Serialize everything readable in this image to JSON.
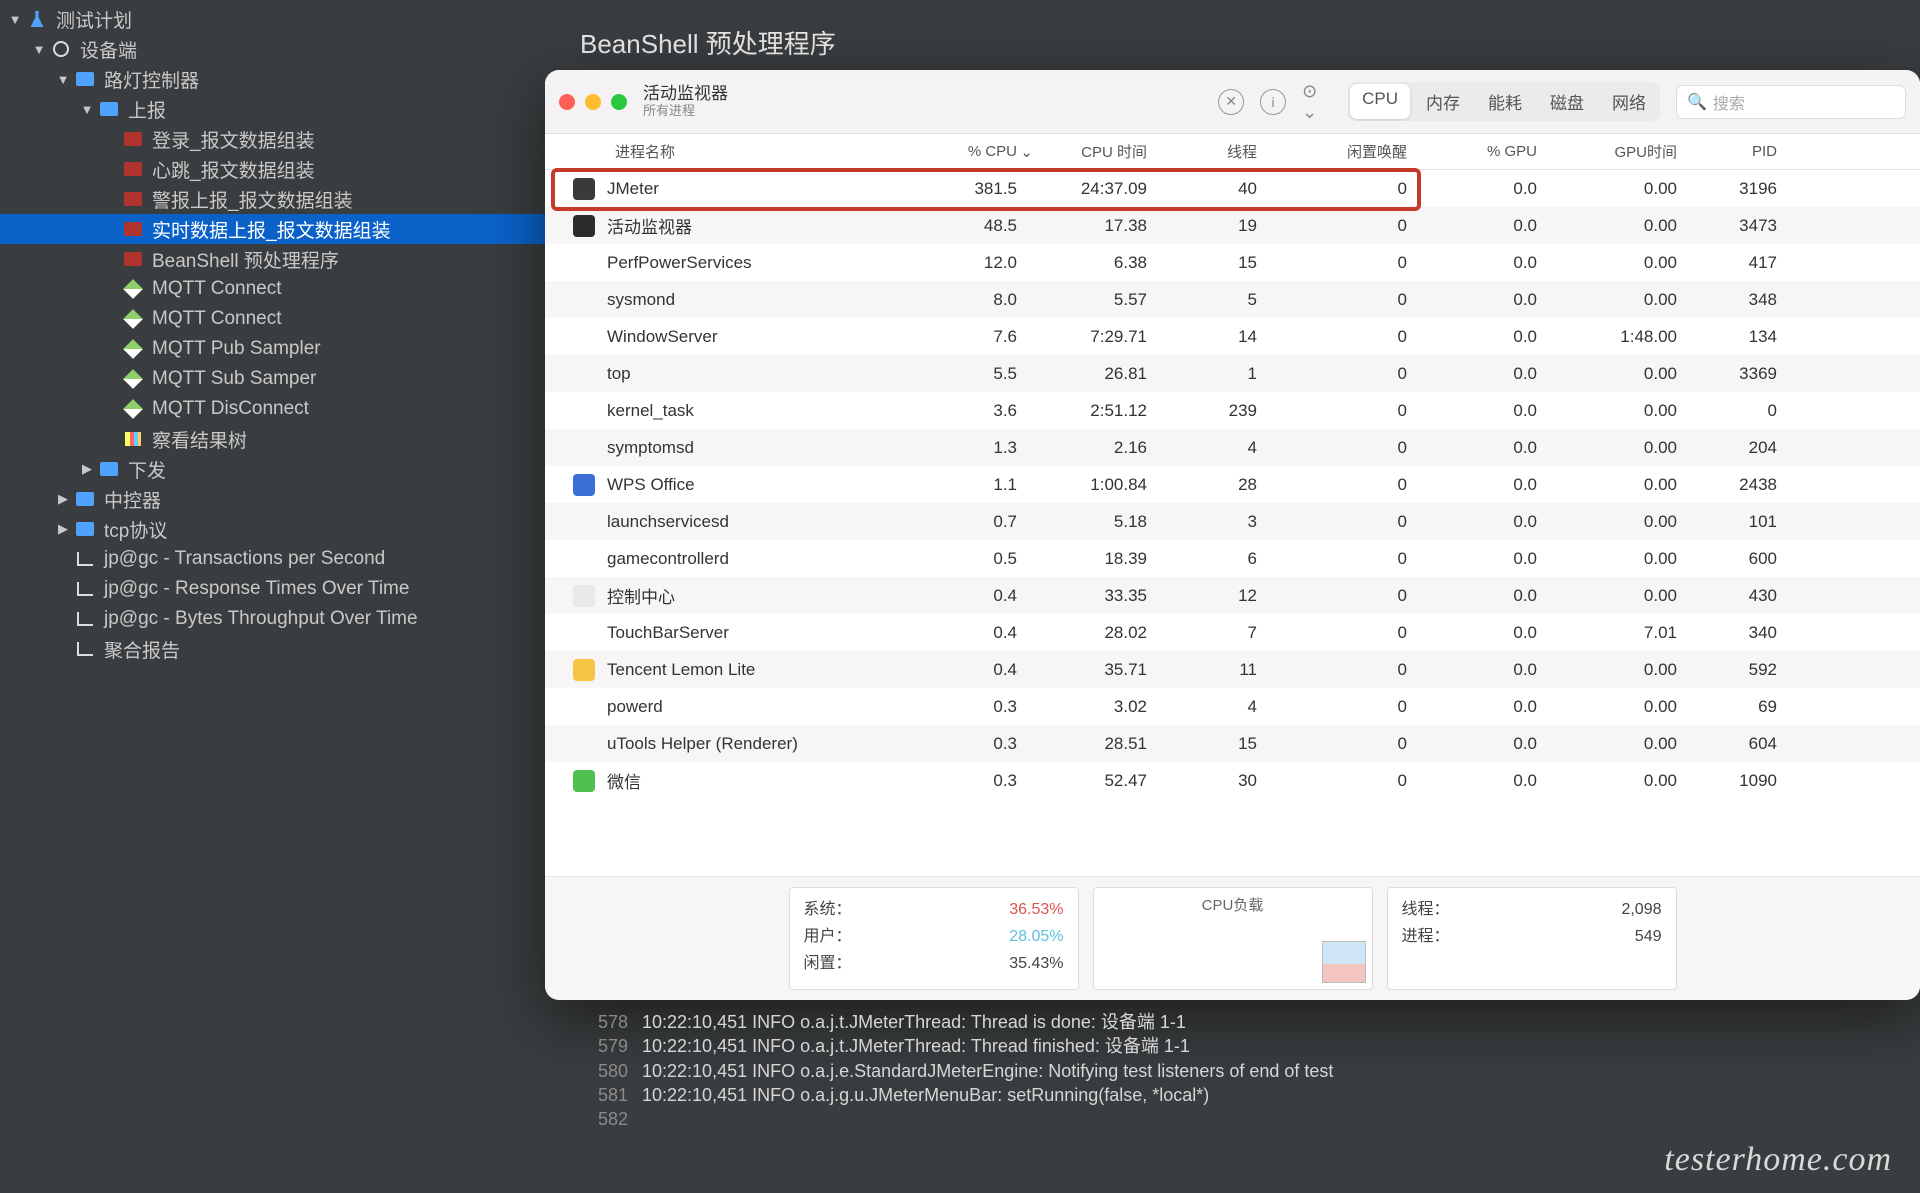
{
  "page_title": "BeanShell 预处理程序",
  "sidebar": {
    "items": [
      {
        "label": "测试计划",
        "indent": 0,
        "disc": "▼",
        "icon": "flask"
      },
      {
        "label": "设备端",
        "indent": 1,
        "disc": "▼",
        "icon": "gear"
      },
      {
        "label": "路灯控制器",
        "indent": 2,
        "disc": "▼",
        "icon": "monitor"
      },
      {
        "label": "上报",
        "indent": 3,
        "disc": "▼",
        "icon": "monitor"
      },
      {
        "label": "登录_报文数据组装",
        "indent": 4,
        "disc": "",
        "icon": "red"
      },
      {
        "label": "心跳_报文数据组装",
        "indent": 4,
        "disc": "",
        "icon": "red"
      },
      {
        "label": "警报上报_报文数据组装",
        "indent": 4,
        "disc": "",
        "icon": "red"
      },
      {
        "label": "实时数据上报_报文数据组装",
        "indent": 4,
        "disc": "",
        "icon": "red",
        "selected": true
      },
      {
        "label": "BeanShell 预处理程序",
        "indent": 4,
        "disc": "",
        "icon": "red"
      },
      {
        "label": "MQTT Connect",
        "indent": 4,
        "disc": "",
        "icon": "pen"
      },
      {
        "label": "MQTT Connect",
        "indent": 4,
        "disc": "",
        "icon": "pen"
      },
      {
        "label": "MQTT Pub Sampler",
        "indent": 4,
        "disc": "",
        "icon": "pen"
      },
      {
        "label": "MQTT  Sub Samper",
        "indent": 4,
        "disc": "",
        "icon": "pen"
      },
      {
        "label": "MQTT DisConnect",
        "indent": 4,
        "disc": "",
        "icon": "pen"
      },
      {
        "label": "察看结果树",
        "indent": 4,
        "disc": "",
        "icon": "chart"
      },
      {
        "label": "下发",
        "indent": 3,
        "disc": "▶",
        "icon": "monitor"
      },
      {
        "label": "中控器",
        "indent": 2,
        "disc": "▶",
        "icon": "monitor"
      },
      {
        "label": "tcp协议",
        "indent": 2,
        "disc": "▶",
        "icon": "monitor"
      },
      {
        "label": "jp@gc - Transactions per Second",
        "indent": 2,
        "disc": "",
        "icon": "graph"
      },
      {
        "label": "jp@gc - Response Times Over Time",
        "indent": 2,
        "disc": "",
        "icon": "graph"
      },
      {
        "label": "jp@gc - Bytes Throughput Over Time",
        "indent": 2,
        "disc": "",
        "icon": "graph"
      },
      {
        "label": "聚合报告",
        "indent": 2,
        "disc": "",
        "icon": "graph"
      }
    ]
  },
  "activity_monitor": {
    "title": "活动监视器",
    "subtitle": "所有进程",
    "tabs": [
      "CPU",
      "内存",
      "能耗",
      "磁盘",
      "网络"
    ],
    "active_tab": 0,
    "search_placeholder": "搜索",
    "columns": [
      "进程名称",
      "% CPU",
      "CPU 时间",
      "线程",
      "闲置唤醒",
      "% GPU",
      "GPU时间",
      "PID"
    ],
    "sorted_col": 1,
    "highlight_row": 0,
    "processes": [
      {
        "icon": "#3a3a3a",
        "name": "JMeter",
        "cpu": "381.5",
        "time": "24:37.09",
        "threads": "40",
        "wake": "0",
        "gpu": "0.0",
        "gputime": "0.00",
        "pid": "3196"
      },
      {
        "icon": "#2b2b2b",
        "name": "活动监视器",
        "cpu": "48.5",
        "time": "17.38",
        "threads": "19",
        "wake": "0",
        "gpu": "0.0",
        "gputime": "0.00",
        "pid": "3473"
      },
      {
        "icon": "",
        "name": "PerfPowerServices",
        "cpu": "12.0",
        "time": "6.38",
        "threads": "15",
        "wake": "0",
        "gpu": "0.0",
        "gputime": "0.00",
        "pid": "417"
      },
      {
        "icon": "",
        "name": "sysmond",
        "cpu": "8.0",
        "time": "5.57",
        "threads": "5",
        "wake": "0",
        "gpu": "0.0",
        "gputime": "0.00",
        "pid": "348"
      },
      {
        "icon": "",
        "name": "WindowServer",
        "cpu": "7.6",
        "time": "7:29.71",
        "threads": "14",
        "wake": "0",
        "gpu": "0.0",
        "gputime": "1:48.00",
        "pid": "134"
      },
      {
        "icon": "",
        "name": "top",
        "cpu": "5.5",
        "time": "26.81",
        "threads": "1",
        "wake": "0",
        "gpu": "0.0",
        "gputime": "0.00",
        "pid": "3369"
      },
      {
        "icon": "",
        "name": "kernel_task",
        "cpu": "3.6",
        "time": "2:51.12",
        "threads": "239",
        "wake": "0",
        "gpu": "0.0",
        "gputime": "0.00",
        "pid": "0"
      },
      {
        "icon": "",
        "name": "symptomsd",
        "cpu": "1.3",
        "time": "2.16",
        "threads": "4",
        "wake": "0",
        "gpu": "0.0",
        "gputime": "0.00",
        "pid": "204"
      },
      {
        "icon": "#3a6fd8",
        "name": "WPS Office",
        "cpu": "1.1",
        "time": "1:00.84",
        "threads": "28",
        "wake": "0",
        "gpu": "0.0",
        "gputime": "0.00",
        "pid": "2438"
      },
      {
        "icon": "",
        "name": "launchservicesd",
        "cpu": "0.7",
        "time": "5.18",
        "threads": "3",
        "wake": "0",
        "gpu": "0.0",
        "gputime": "0.00",
        "pid": "101"
      },
      {
        "icon": "",
        "name": "gamecontrollerd",
        "cpu": "0.5",
        "time": "18.39",
        "threads": "6",
        "wake": "0",
        "gpu": "0.0",
        "gputime": "0.00",
        "pid": "600"
      },
      {
        "icon": "#e9e9e9",
        "name": "控制中心",
        "cpu": "0.4",
        "time": "33.35",
        "threads": "12",
        "wake": "0",
        "gpu": "0.0",
        "gputime": "0.00",
        "pid": "430"
      },
      {
        "icon": "",
        "name": "TouchBarServer",
        "cpu": "0.4",
        "time": "28.02",
        "threads": "7",
        "wake": "0",
        "gpu": "0.0",
        "gputime": "7.01",
        "pid": "340"
      },
      {
        "icon": "#f6c544",
        "name": "Tencent Lemon Lite",
        "cpu": "0.4",
        "time": "35.71",
        "threads": "11",
        "wake": "0",
        "gpu": "0.0",
        "gputime": "0.00",
        "pid": "592"
      },
      {
        "icon": "",
        "name": "powerd",
        "cpu": "0.3",
        "time": "3.02",
        "threads": "4",
        "wake": "0",
        "gpu": "0.0",
        "gputime": "0.00",
        "pid": "69"
      },
      {
        "icon": "",
        "name": "uTools Helper (Renderer)",
        "cpu": "0.3",
        "time": "28.51",
        "threads": "15",
        "wake": "0",
        "gpu": "0.0",
        "gputime": "0.00",
        "pid": "604"
      },
      {
        "icon": "#4fbf4f",
        "name": "微信",
        "cpu": "0.3",
        "time": "52.47",
        "threads": "30",
        "wake": "0",
        "gpu": "0.0",
        "gputime": "0.00",
        "pid": "1090"
      }
    ],
    "footer": {
      "left": [
        {
          "label": "系统：",
          "value": "36.53%",
          "color": "#d9534f"
        },
        {
          "label": "用户：",
          "value": "28.05%",
          "color": "#5bc0de"
        },
        {
          "label": "闲置：",
          "value": "35.43%",
          "color": "#444"
        }
      ],
      "chart_title": "CPU负载",
      "right": [
        {
          "label": "线程：",
          "value": "2,098"
        },
        {
          "label": "进程：",
          "value": "549"
        }
      ]
    }
  },
  "chart_data": {
    "type": "area",
    "title": "CPU负载",
    "series": [
      {
        "name": "系统",
        "color": "#d9534f",
        "latest": 36.53
      },
      {
        "name": "用户",
        "color": "#5bc0de",
        "latest": 28.05
      }
    ],
    "ylim": [
      0,
      100
    ],
    "note": "mini sparkline at right edge of footer"
  },
  "console": {
    "lines": [
      {
        "n": "578",
        "t": "10:22:10,451 INFO o.a.j.t.JMeterThread: Thread is done: 设备端 1-1"
      },
      {
        "n": "579",
        "t": "10:22:10,451 INFO o.a.j.t.JMeterThread: Thread finished: 设备端 1-1"
      },
      {
        "n": "580",
        "t": "10:22:10,451 INFO o.a.j.e.StandardJMeterEngine: Notifying test listeners of end of test"
      },
      {
        "n": "581",
        "t": "10:22:10,451 INFO o.a.j.g.u.JMeterMenuBar: setRunning(false, *local*)"
      },
      {
        "n": "582",
        "t": ""
      }
    ]
  },
  "watermark": "testerhome.com"
}
